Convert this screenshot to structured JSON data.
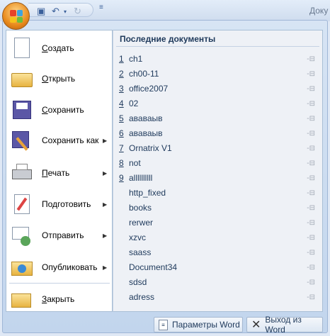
{
  "title_bar": {
    "title": "Доку"
  },
  "quick_access": {
    "save": "save-icon",
    "undo": "undo-icon",
    "redo": "redo-icon",
    "customize": "customize-icon"
  },
  "menu": {
    "items": [
      {
        "label": "Создать",
        "u": "С",
        "rest": "оздать",
        "submenu": false,
        "icon": "new-document-icon"
      },
      {
        "label": "Открыть",
        "u": "О",
        "rest": "ткрыть",
        "submenu": false,
        "icon": "open-folder-icon"
      },
      {
        "label": "Сохранить",
        "u": "С",
        "rest": "охранить",
        "submenu": false,
        "icon": "save-icon"
      },
      {
        "label": "Сохранить как",
        "u": "",
        "rest": "Сохранить как",
        "submenu": true,
        "icon": "save-as-icon"
      },
      {
        "label": "Печать",
        "u": "П",
        "rest": "ечать",
        "submenu": true,
        "icon": "printer-icon"
      },
      {
        "label": "Подготовить",
        "u": "",
        "rest": "Подготовить",
        "submenu": true,
        "icon": "prepare-icon"
      },
      {
        "label": "Отправить",
        "u": "",
        "rest": "Отправить",
        "submenu": true,
        "icon": "send-icon"
      },
      {
        "label": "Опубликовать",
        "u": "",
        "rest": "Опубликовать",
        "submenu": true,
        "icon": "publish-icon"
      },
      {
        "label": "Закрыть",
        "u": "З",
        "rest": "акрыть",
        "submenu": false,
        "icon": "close-folder-icon"
      }
    ]
  },
  "recent": {
    "heading": "Последние документы",
    "items": [
      {
        "num": "1",
        "name": "ch1"
      },
      {
        "num": "2",
        "name": "ch00-11"
      },
      {
        "num": "3",
        "name": "office2007"
      },
      {
        "num": "4",
        "name": "02"
      },
      {
        "num": "5",
        "name": "ававаыв"
      },
      {
        "num": "6",
        "name": "ававаыв"
      },
      {
        "num": "7",
        "name": "Ornatrix V1"
      },
      {
        "num": "8",
        "name": "not"
      },
      {
        "num": "9",
        "name": "allllllllll"
      },
      {
        "num": "",
        "name": "http_fixed"
      },
      {
        "num": "",
        "name": "books"
      },
      {
        "num": "",
        "name": "rerwer"
      },
      {
        "num": "",
        "name": "xzvc"
      },
      {
        "num": "",
        "name": "saass"
      },
      {
        "num": "",
        "name": "Document34"
      },
      {
        "num": "",
        "name": "sdsd"
      },
      {
        "num": "",
        "name": "adress"
      }
    ]
  },
  "footer": {
    "options": "Параметры Word",
    "exit": "Выход из Word"
  }
}
